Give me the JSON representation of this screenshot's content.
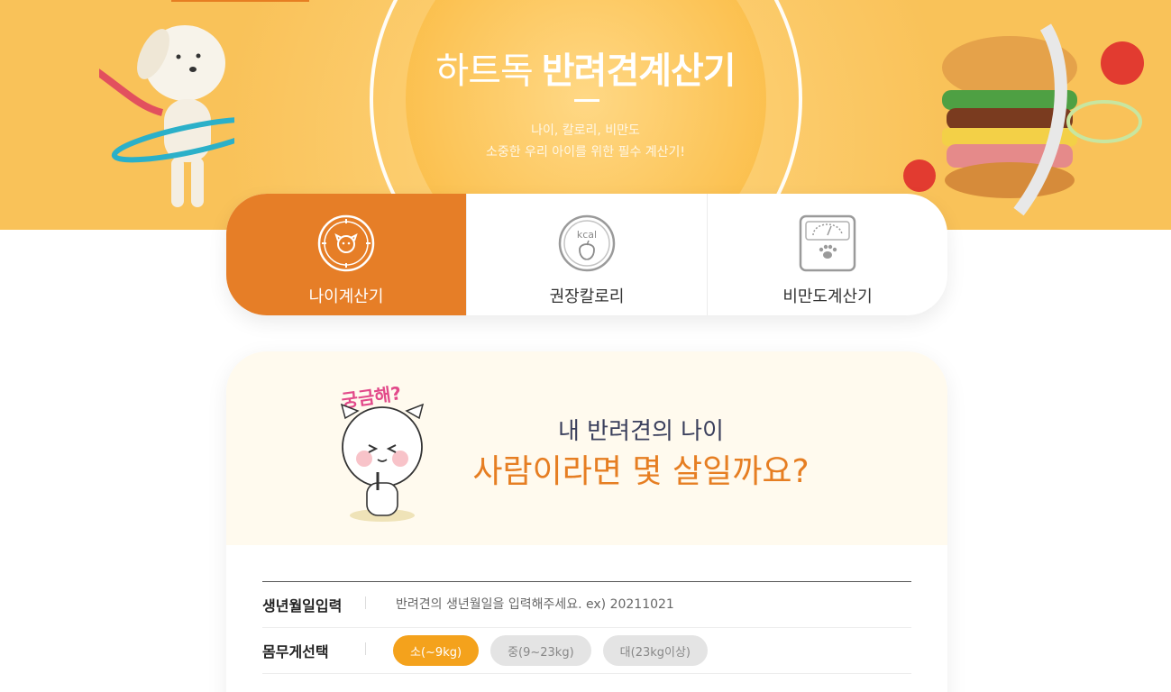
{
  "hero": {
    "brand": "하트독",
    "title": "반려견계산기",
    "sub_line1": "나이, 칼로리, 비만도",
    "sub_line2": "소중한 우리 아이를 위한 필수 계산기!"
  },
  "tabs": [
    {
      "label": "나이계산기",
      "active": true
    },
    {
      "label": "권장칼로리",
      "active": false
    },
    {
      "label": "비만도계산기",
      "active": false
    }
  ],
  "question": {
    "line1": "내 반려견의 나이",
    "line2": "사람이라면 몇 살일까요?",
    "badge": "궁금해?"
  },
  "form": {
    "birth_label": "생년월일입력",
    "birth_placeholder": "반려견의 생년월일을 입력해주세요. ex) 20211021",
    "size_label": "몸무게선택",
    "sizes": [
      {
        "label": "소(~9kg)",
        "active": true
      },
      {
        "label": "중(9~23kg)",
        "active": false
      },
      {
        "label": "대(23kg이상)",
        "active": false
      }
    ]
  },
  "colors": {
    "accent": "#e67e27",
    "hero_bg": "#f9c259",
    "button_active": "#f4a21c"
  }
}
